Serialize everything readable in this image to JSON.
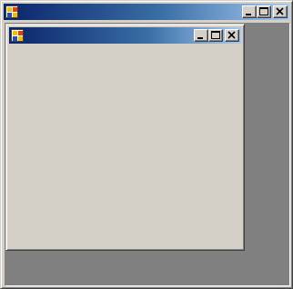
{
  "main_window": {
    "title": "",
    "icon": "app-icon",
    "buttons": {
      "minimize": "minimize-icon",
      "maximize": "maximize-icon",
      "close": "close-icon"
    }
  },
  "child_window": {
    "title": "",
    "icon": "app-icon",
    "buttons": {
      "minimize": "minimize-icon",
      "maximize": "maximize-icon",
      "close": "close-icon"
    }
  },
  "colors": {
    "titlebar_start": "#0a246a",
    "titlebar_end": "#a6caf0",
    "face": "#d4d0c8",
    "mdi_background": "#808080"
  }
}
